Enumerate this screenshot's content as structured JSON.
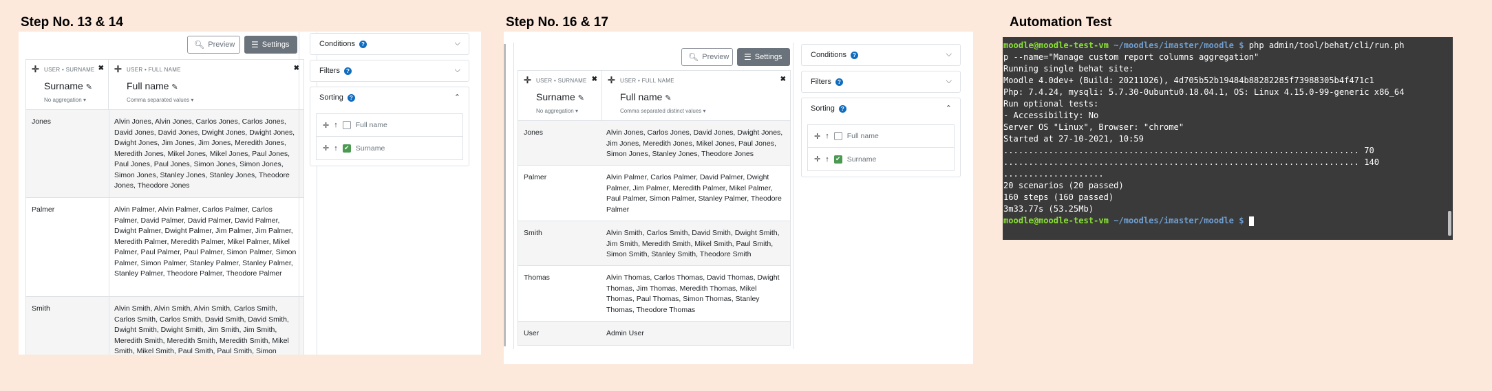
{
  "steps": {
    "step1_title": "Step No. 13 & 14",
    "step2_title": "Step No. 16 & 17",
    "step3_title": "Automation Test"
  },
  "toolbar": {
    "preview_label": "Preview",
    "settings_label": "Settings"
  },
  "columns": {
    "surname": {
      "source": "USER • SURNAME",
      "name": "Surname",
      "aggregation": "No aggregation"
    },
    "fullname_a": {
      "source": "USER • FULL NAME",
      "name": "Full name",
      "aggregation": "Comma separated values"
    },
    "fullname_b": {
      "source": "USER • FULL NAME",
      "name": "Full name",
      "aggregation": "Comma separated distinct values"
    }
  },
  "sidebar": {
    "conditions": "Conditions",
    "filters": "Filters",
    "sorting": "Sorting",
    "sort_items": [
      "Full name",
      "Surname"
    ]
  },
  "panel1_rows": [
    {
      "surname": "Jones",
      "names": "Alvin Jones, Alvin Jones, Carlos Jones, Carlos Jones, David Jones, David Jones, Dwight Jones, Dwight Jones, Dwight Jones, Jim Jones, Jim Jones, Meredith Jones, Meredith Jones, Mikel Jones, Mikel Jones, Paul Jones, Paul Jones, Paul Jones, Simon Jones, Simon Jones, Simon Jones, Stanley Jones, Stanley Jones, Theodore Jones, Theodore Jones"
    },
    {
      "surname": "Palmer",
      "names": "Alvin Palmer, Alvin Palmer, Carlos Palmer, Carlos Palmer, David Palmer, David Palmer, David Palmer, Dwight Palmer, Dwight Palmer, Jim Palmer, Jim Palmer, Meredith Palmer, Meredith Palmer, Mikel Palmer, Mikel Palmer, Paul Palmer, Paul Palmer, Simon Palmer, Simon Palmer, Simon Palmer, Stanley Palmer, Stanley Palmer, Stanley Palmer, Theodore Palmer, Theodore Palmer"
    },
    {
      "surname": "Smith",
      "names": "Alvin Smith, Alvin Smith, Alvin Smith, Carlos Smith, Carlos Smith, Carlos Smith, David Smith, David Smith, Dwight Smith, Dwight Smith, Jim Smith, Jim Smith, Meredith Smith, Meredith Smith, Meredith Smith, Mikel Smith, Mikel Smith, Paul Smith, Paul Smith, Simon"
    }
  ],
  "panel2_rows": [
    {
      "surname": "Jones",
      "names": "Alvin Jones, Carlos Jones, David Jones, Dwight Jones, Jim Jones, Meredith Jones, Mikel Jones, Paul Jones, Simon Jones, Stanley Jones, Theodore Jones"
    },
    {
      "surname": "Palmer",
      "names": "Alvin Palmer, Carlos Palmer, David Palmer, Dwight Palmer, Jim Palmer, Meredith Palmer, Mikel Palmer, Paul Palmer, Simon Palmer, Stanley Palmer, Theodore Palmer"
    },
    {
      "surname": "Smith",
      "names": "Alvin Smith, Carlos Smith, David Smith, Dwight Smith, Jim Smith, Meredith Smith, Mikel Smith, Paul Smith, Simon Smith, Stanley Smith, Theodore Smith"
    },
    {
      "surname": "Thomas",
      "names": "Alvin Thomas, Carlos Thomas, David Thomas, Dwight Thomas, Jim Thomas, Meredith Thomas, Mikel Thomas, Paul Thomas, Simon Thomas, Stanley Thomas, Theodore Thomas"
    },
    {
      "surname": "User",
      "names": "Admin User"
    }
  ],
  "terminal": {
    "prompt_user": "moodle@moodle-test-vm",
    "prompt_path": "~/moodles/imaster/moodle",
    "prompt_symbol": "$",
    "command_line1": "php admin/tool/behat/cli/run.ph",
    "command_line2": "p --name=\"Manage custom report columns aggregation\"",
    "out": [
      "Running single behat site:",
      "Moodle 4.0dev+ (Build: 20211026), 4d705b52b19484b88282285f73988305b4f471c1",
      "Php: 7.4.24, mysqli: 5.7.30-0ubuntu0.18.04.1, OS: Linux 4.15.0-99-generic x86_64",
      "Run optional tests:",
      "- Accessibility: No",
      "Server OS \"Linux\", Browser: \"chrome\"",
      "Started at 27-10-2021, 10:59",
      "....................................................................... 70",
      "....................................................................... 140",
      "....................",
      "",
      "20 scenarios (20 passed)",
      "160 steps (160 passed)",
      "3m33.77s (53.25Mb)"
    ]
  }
}
